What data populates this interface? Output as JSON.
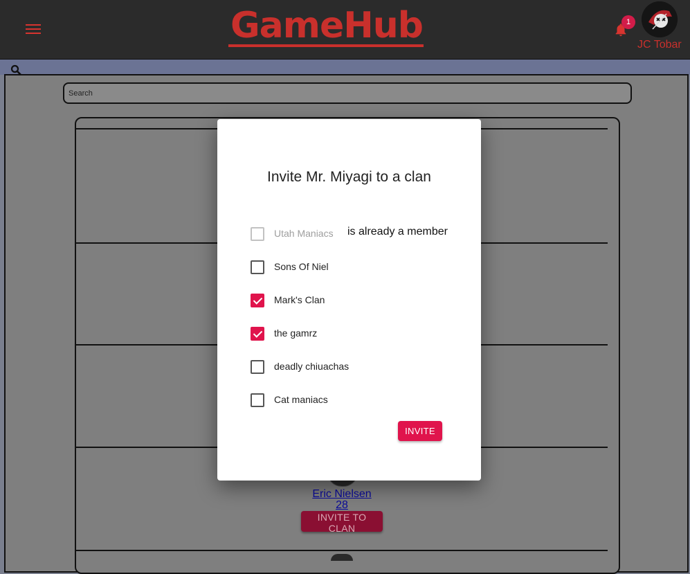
{
  "header": {
    "logo": "GameHub",
    "notification_count": "1",
    "username": "JC Tobar",
    "accent_color": "#c9302c"
  },
  "search": {
    "placeholder": "Search"
  },
  "list": {
    "rows": [
      {
        "name": "Eric Nielsen",
        "age": "28",
        "invite_label": "INVITE TO CLAN"
      }
    ]
  },
  "dialog": {
    "title": "Invite Mr. Miyagi to a clan",
    "member_note": "is already a member",
    "options": [
      {
        "label": "Utah Maniacs",
        "checked": false,
        "disabled": true
      },
      {
        "label": "Sons Of Niel",
        "checked": false,
        "disabled": false
      },
      {
        "label": "Mark's Clan",
        "checked": true,
        "disabled": false
      },
      {
        "label": "the gamrz",
        "checked": true,
        "disabled": false
      },
      {
        "label": "deadly chiuachas",
        "checked": false,
        "disabled": false
      },
      {
        "label": "Cat maniacs",
        "checked": false,
        "disabled": false
      }
    ],
    "invite_label": "INVITE",
    "accent_color": "#e0144c"
  }
}
